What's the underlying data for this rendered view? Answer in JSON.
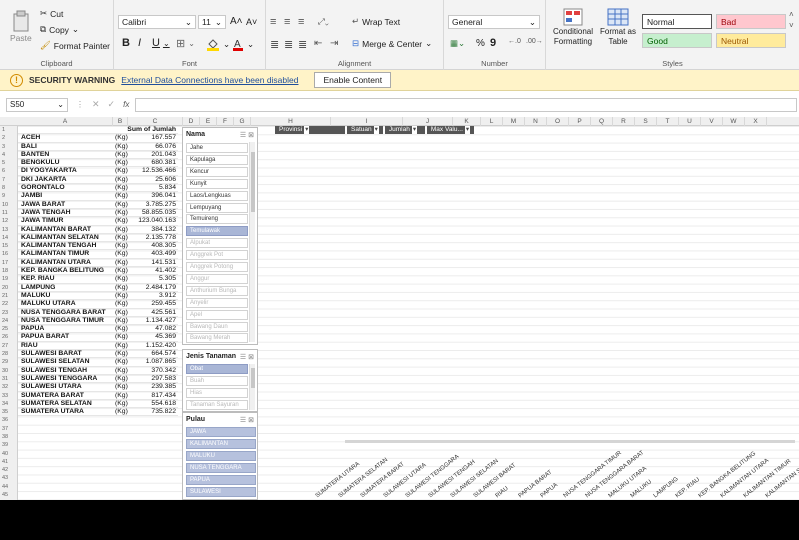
{
  "ribbon": {
    "clipboard": {
      "paste": "Paste",
      "cut": "Cut",
      "copy": "Copy",
      "format_painter": "Format Painter",
      "group": "Clipboard"
    },
    "font": {
      "family": "Calibri",
      "size": "11",
      "bold": "B",
      "italic": "I",
      "underline": "U",
      "group": "Font"
    },
    "alignment": {
      "wrap_text": "Wrap Text",
      "merge_center": "Merge & Center",
      "group": "Alignment"
    },
    "number": {
      "format": "General",
      "group": "Number",
      "percent": "%",
      "comma": "9"
    },
    "styles": {
      "conditional": "Conditional Formatting",
      "format_table": "Format as Table",
      "group": "Styles",
      "cells": [
        {
          "label": "Normal",
          "bg": "#ffffff",
          "fg": "#222222"
        },
        {
          "label": "Bad",
          "bg": "#ffc7ce",
          "fg": "#9c0006"
        },
        {
          "label": "Good",
          "bg": "#c6efce",
          "fg": "#006100"
        },
        {
          "label": "Neutral",
          "bg": "#ffeb9c",
          "fg": "#9c5700"
        }
      ]
    }
  },
  "security": {
    "title": "SECURITY WARNING",
    "message": "External Data Connections have been disabled",
    "button": "Enable Content"
  },
  "formula": {
    "name_box": "S50",
    "fx": "fx"
  },
  "columns": [
    "A",
    "B",
    "C",
    "D",
    "E",
    "F",
    "G",
    "H",
    "I",
    "J",
    "K",
    "L",
    "M",
    "N",
    "O",
    "P",
    "Q",
    "R",
    "S",
    "T",
    "U",
    "V",
    "W",
    "X"
  ],
  "table": {
    "header_sum": "Sum of Jumlah",
    "rows": [
      {
        "p": "ACEH",
        "u": "(Kg)",
        "v": "167.557"
      },
      {
        "p": "BALI",
        "u": "(Kg)",
        "v": "66.076"
      },
      {
        "p": "BANTEN",
        "u": "(Kg)",
        "v": "201.043"
      },
      {
        "p": "BENGKULU",
        "u": "(Kg)",
        "v": "680.381"
      },
      {
        "p": "DI YOGYAKARTA",
        "u": "(Kg)",
        "v": "12.536.466"
      },
      {
        "p": "DKI JAKARTA",
        "u": "(Kg)",
        "v": "25.606"
      },
      {
        "p": "GORONTALO",
        "u": "(Kg)",
        "v": "5.834"
      },
      {
        "p": "JAMBI",
        "u": "(Kg)",
        "v": "396.041"
      },
      {
        "p": "JAWA BARAT",
        "u": "(Kg)",
        "v": "3.785.275"
      },
      {
        "p": "JAWA TENGAH",
        "u": "(Kg)",
        "v": "58.855.035"
      },
      {
        "p": "JAWA TIMUR",
        "u": "(Kg)",
        "v": "123.040.163"
      },
      {
        "p": "KALIMANTAN BARAT",
        "u": "(Kg)",
        "v": "384.132"
      },
      {
        "p": "KALIMANTAN SELATAN",
        "u": "(Kg)",
        "v": "2.135.778"
      },
      {
        "p": "KALIMANTAN TENGAH",
        "u": "(Kg)",
        "v": "408.305"
      },
      {
        "p": "KALIMANTAN TIMUR",
        "u": "(Kg)",
        "v": "403.499"
      },
      {
        "p": "KALIMANTAN UTARA",
        "u": "(Kg)",
        "v": "141.531"
      },
      {
        "p": "KEP. BANGKA BELITUNG",
        "u": "(Kg)",
        "v": "41.402"
      },
      {
        "p": "KEP. RIAU",
        "u": "(Kg)",
        "v": "5.305"
      },
      {
        "p": "LAMPUNG",
        "u": "(Kg)",
        "v": "2.484.179"
      },
      {
        "p": "MALUKU",
        "u": "(Kg)",
        "v": "3.912"
      },
      {
        "p": "MALUKU UTARA",
        "u": "(Kg)",
        "v": "259.455"
      },
      {
        "p": "NUSA TENGGARA BARAT",
        "u": "(Kg)",
        "v": "425.561"
      },
      {
        "p": "NUSA TENGGARA TIMUR",
        "u": "(Kg)",
        "v": "1.134.427"
      },
      {
        "p": "PAPUA",
        "u": "(Kg)",
        "v": "47.082"
      },
      {
        "p": "PAPUA BARAT",
        "u": "(Kg)",
        "v": "45.369"
      },
      {
        "p": "RIAU",
        "u": "(Kg)",
        "v": "1.152.420"
      },
      {
        "p": "SULAWESI BARAT",
        "u": "(Kg)",
        "v": "664.574"
      },
      {
        "p": "SULAWESI SELATAN",
        "u": "(Kg)",
        "v": "1.087.865"
      },
      {
        "p": "SULAWESI TENGAH",
        "u": "(Kg)",
        "v": "370.342"
      },
      {
        "p": "SULAWESI TENGGARA",
        "u": "(Kg)",
        "v": "297.583"
      },
      {
        "p": "SULAWESI UTARA",
        "u": "(Kg)",
        "v": "239.385"
      },
      {
        "p": "SUMATERA BARAT",
        "u": "(Kg)",
        "v": "817.434"
      },
      {
        "p": "SUMATERA SELATAN",
        "u": "(Kg)",
        "v": "554.618"
      },
      {
        "p": "SUMATERA UTARA",
        "u": "(Kg)",
        "v": "735.822"
      }
    ]
  },
  "slicer_nama": {
    "title": "Nama",
    "items": [
      {
        "label": "Jahe",
        "state": "normal"
      },
      {
        "label": "Kapulaga",
        "state": "normal"
      },
      {
        "label": "Kencur",
        "state": "normal"
      },
      {
        "label": "Kunyit",
        "state": "normal"
      },
      {
        "label": "Laos/Lengkuas",
        "state": "normal"
      },
      {
        "label": "Lempuyang",
        "state": "normal"
      },
      {
        "label": "Temuireng",
        "state": "normal"
      },
      {
        "label": "Temulawak",
        "state": "sel"
      },
      {
        "label": "Alpukat",
        "state": "dim"
      },
      {
        "label": "Anggrek Pot",
        "state": "dim"
      },
      {
        "label": "Anggrek Potong",
        "state": "dim"
      },
      {
        "label": "Anggur",
        "state": "dim"
      },
      {
        "label": "Anthurium Bunga",
        "state": "dim"
      },
      {
        "label": "Anyelir",
        "state": "dim"
      },
      {
        "label": "Apel",
        "state": "dim"
      },
      {
        "label": "Bawang Daun",
        "state": "dim"
      },
      {
        "label": "Bawang Merah",
        "state": "dim"
      }
    ]
  },
  "slicer_jenis": {
    "title": "Jenis Tanaman",
    "items": [
      {
        "label": "Obat",
        "state": "sel"
      },
      {
        "label": "Buah",
        "state": "dim"
      },
      {
        "label": "Hias",
        "state": "dim"
      },
      {
        "label": "Tanaman Sayuran",
        "state": "dim"
      }
    ]
  },
  "slicer_pulau": {
    "title": "Pulau",
    "items": [
      {
        "label": "JAWA",
        "state": "selb"
      },
      {
        "label": "KALIMANTAN",
        "state": "selb"
      },
      {
        "label": "MALUKU",
        "state": "selb"
      },
      {
        "label": "NUSA TENGGARA",
        "state": "selb"
      },
      {
        "label": "PAPUA",
        "state": "selb"
      },
      {
        "label": "SULAWESI",
        "state": "selb"
      }
    ]
  },
  "pivot_fields": [
    "Provinsi",
    "Satuan",
    "Jumlah",
    "Max Valu..."
  ],
  "chart_labels": [
    "SUMATERA UTARA",
    "SUMATERA SELATAN",
    "SUMATERA BARAT",
    "SULAWESI UTARA",
    "SULAWESI TENGGARA",
    "SULAWESI TENGAH",
    "SULAWESI SELATAN",
    "SULAWESI BARAT",
    "RIAU",
    "PAPUA BARAT",
    "PAPUA",
    "NUSA TENGGARA TIMUR",
    "NUSA TENGGARA BARAT",
    "MALUKU UTARA",
    "MALUKU",
    "LAMPUNG",
    "KEP. RIAU",
    "KEP. BANGKA BELITUNG",
    "KALIMANTAN UTARA",
    "KALIMANTAN TIMUR",
    "KALIMANTAN SELATAN"
  ]
}
